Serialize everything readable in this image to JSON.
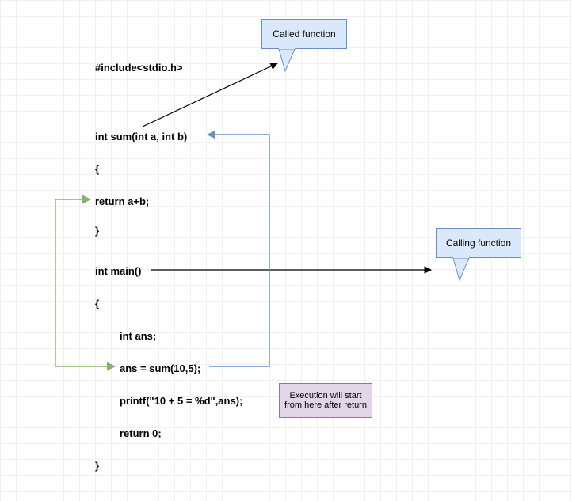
{
  "code": {
    "include": "#include<stdio.h>",
    "sum_decl": "int sum(int a, int b)",
    "brace_open1": "{",
    "return_ab": "return a+b;",
    "brace_close1": "}",
    "main_decl": "int main()",
    "brace_open2": "{",
    "int_ans": "int ans;",
    "ans_call": "ans = sum(10,5);",
    "printf": "printf(\"10 + 5 = %d\",ans);",
    "return0": "return 0;",
    "brace_close2": "}"
  },
  "callouts": {
    "called": "Called function",
    "calling": "Calling function",
    "execution": "Execution will start from here after return"
  }
}
